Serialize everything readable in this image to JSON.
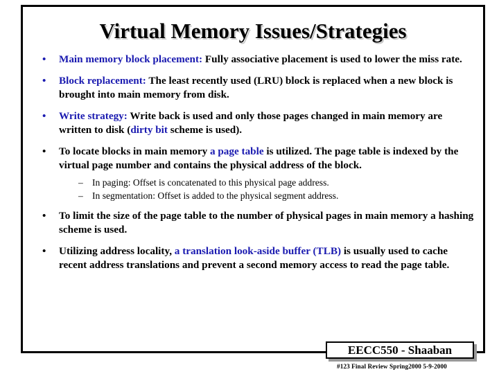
{
  "slide": {
    "title": "Virtual Memory Issues/Strategies",
    "accent_blue": "#1a1ab0",
    "text_black": "#000000",
    "shadow_gray": "#c8c8c8"
  },
  "bullets": [
    {
      "marker": "•",
      "marker_color": "blue",
      "lead": "Main memory block placement:",
      "lead_style": "blue",
      "rest_1": "  Fully associative placement is used to lower the miss rate."
    },
    {
      "marker": "•",
      "marker_color": "blue",
      "lead": "Block replacement:",
      "lead_style": "blue",
      "rest_1": "   The least recently used (LRU) block is replaced when a new block is brought into main memory  from disk."
    },
    {
      "marker": "•",
      "marker_color": "blue",
      "lead": "Write strategy:",
      "lead_style": "blue",
      "rest_1": "   Write back is used and only those pages changed in main memory are written to disk (",
      "kw_1": "dirty bit",
      "rest_2": " scheme is used)."
    },
    {
      "marker": "•",
      "marker_color": "black",
      "rest_1": "To locate blocks in main memory ",
      "kw_1": "a page table",
      "rest_2": " is utilized.  The page table is indexed by the virtual page number and contains the physical address of the block.",
      "sub": [
        {
          "marker": "–",
          "text": "In paging: Offset is concatenated to this physical page address."
        },
        {
          "marker": "–",
          "text": "In segmentation: Offset is added to the physical segment address."
        }
      ]
    },
    {
      "marker": "•",
      "marker_color": "black",
      "rest_1": "To limit  the size of the page table to the number of physical pages in main memory a hashing scheme is used."
    },
    {
      "marker": "•",
      "marker_color": "black",
      "rest_1": "Utilizing address locality, ",
      "kw_1": "a translation look-aside buffer",
      "rest_2": " ",
      "kw_2": "(TLB)",
      "rest_3": " is usually used to cache recent address translations and prevent a second memory access to read the page table."
    }
  ],
  "footer": {
    "title": "EECC550 - Shaaban",
    "subtitle": "#123   Final Review   Spring2000   5-9-2000"
  }
}
